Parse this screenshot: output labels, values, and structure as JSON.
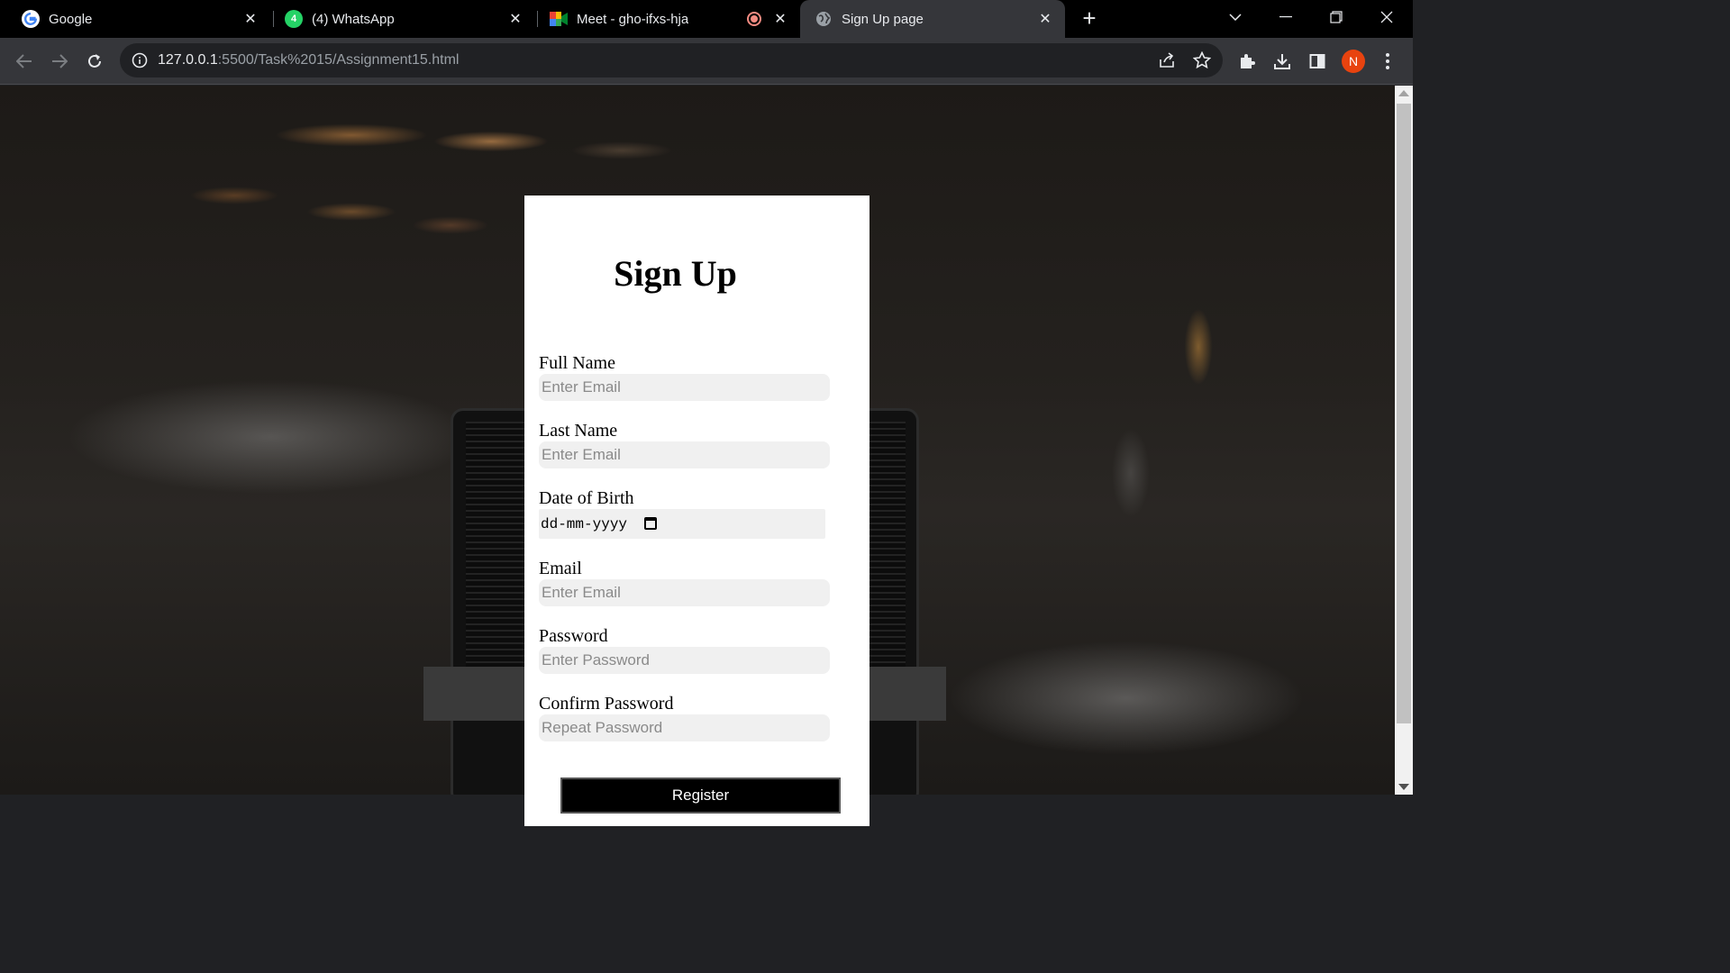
{
  "browser": {
    "tabs": [
      {
        "title": "Google",
        "favicon": "google-icon"
      },
      {
        "title": "(4) WhatsApp",
        "favicon": "whatsapp-icon",
        "badge": "4"
      },
      {
        "title": "Meet - gho-ifxs-hja",
        "favicon": "meet-icon",
        "recording": true
      },
      {
        "title": "Sign Up page",
        "favicon": "globe-icon",
        "active": true
      }
    ],
    "new_tab": "+",
    "close_glyph": "✕",
    "url_host": "127.0.0.1",
    "url_rest": ":5500/Task%2015/Assignment15.html",
    "profile_initial": "N",
    "profile_color": "#e8430f"
  },
  "form": {
    "title": "Sign Up",
    "fields": [
      {
        "label": "Full Name",
        "placeholder": "Enter Email"
      },
      {
        "label": "Last Name",
        "placeholder": "Enter Email"
      },
      {
        "label": "Date of Birth",
        "date_placeholder": "dd-mm-yyyy"
      },
      {
        "label": "Email",
        "placeholder": "Enter Email"
      },
      {
        "label": "Password",
        "placeholder": "Enter Password"
      },
      {
        "label": "Confirm Password",
        "placeholder": "Repeat Password"
      }
    ],
    "submit_label": "Register"
  }
}
